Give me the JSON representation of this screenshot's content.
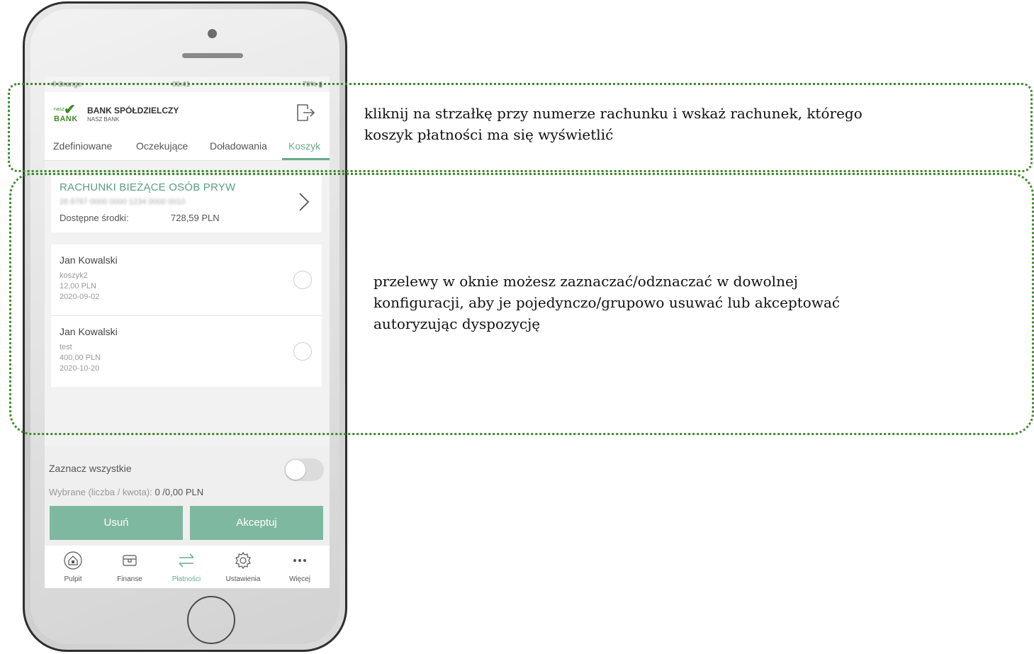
{
  "status_bar": {
    "carrier": "•ll Orange",
    "time": "09:41",
    "battery": "78% ▮"
  },
  "header": {
    "logo_small": "nasz",
    "logo_text": "BANK",
    "bank_name": "BANK SPÓŁDZIELCZY",
    "bank_sub": "NASZ BANK"
  },
  "tabs": [
    {
      "label": "Zdefiniowane",
      "active": false
    },
    {
      "label": "Oczekujące",
      "active": false
    },
    {
      "label": "Doładowania",
      "active": false
    },
    {
      "label": "Koszyk",
      "active": true
    }
  ],
  "account": {
    "name": "RACHUNKI BIEŻĄCE OSÓB PRYW",
    "number": "26 8787 0000 0000 1234 0000 0010",
    "available_label": "Dostępne środki:",
    "available_value": "728,59 PLN"
  },
  "payments": [
    {
      "name": "Jan Kowalski",
      "title": "koszyk2",
      "amount": "12,00 PLN",
      "date": "2020-09-02",
      "selected": false
    },
    {
      "name": "Jan Kowalski",
      "title": "test",
      "amount": "400,00 PLN",
      "date": "2020-10-20",
      "selected": false
    }
  ],
  "bottom": {
    "select_all_label": "Zaznacz wszystkie",
    "select_all_on": false,
    "summary_label": "Wybrane (liczba / kwota):",
    "summary_value": "0 /0,00 PLN",
    "delete_label": "Usuń",
    "accept_label": "Akceptuj"
  },
  "tabbar": [
    {
      "label": "Pulpit",
      "icon": "home-icon",
      "active": false
    },
    {
      "label": "Finanse",
      "icon": "wallet-icon",
      "active": false
    },
    {
      "label": "Płatności",
      "icon": "transfer-arrows-icon",
      "active": true
    },
    {
      "label": "Ustawienia",
      "icon": "gear-icon",
      "active": false
    },
    {
      "label": "Więcej",
      "icon": "more-dots-icon",
      "active": false
    }
  ],
  "captions": {
    "top": [
      "kliknij na strzałkę przy numerze rachunku i wskaż rachunek, którego",
      "koszyk płatności ma się wyświetlić"
    ],
    "middle": [
      "przelewy w oknie możesz zaznaczać/odznaczać w dowolnej",
      "konfiguracji, aby je pojedynczo/grupowo usuwać lub akceptować",
      "autoryzując dyspozycję"
    ]
  },
  "colors": {
    "accent": "#6aaa8a",
    "button": "#7fb8a0",
    "frame": "#3d8a2a",
    "brand": "#3f8a2a"
  }
}
